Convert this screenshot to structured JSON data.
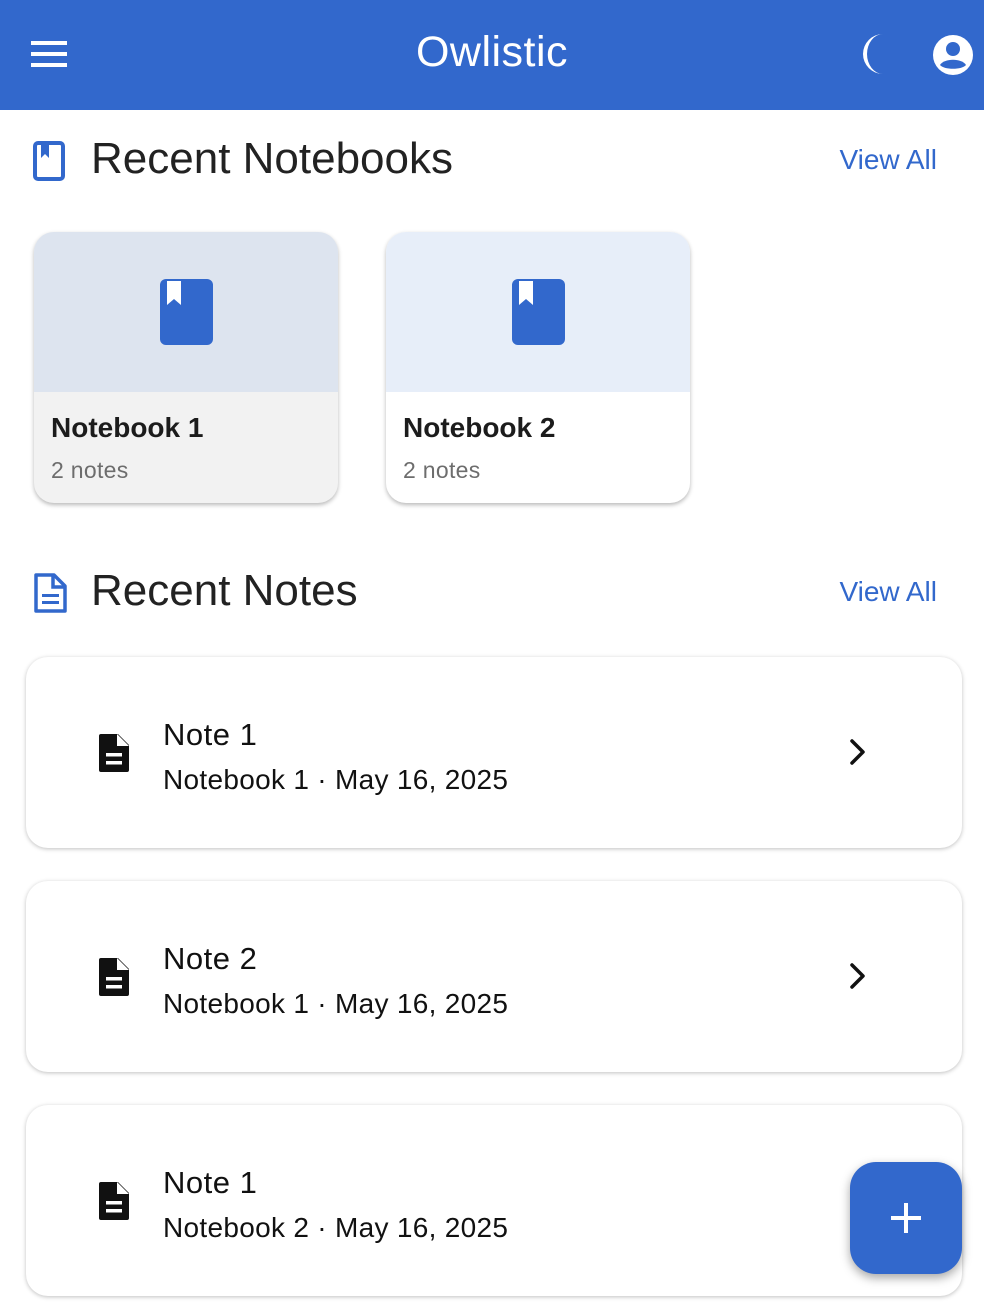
{
  "app": {
    "title": "Owlistic",
    "accent": "#3268cc",
    "icons": {
      "menu": "menu-icon",
      "theme": "moon-icon",
      "account": "account-circle-icon"
    }
  },
  "recent_notebooks": {
    "title": "Recent Notebooks",
    "view_all": "View All",
    "icon": "bookmark-book-icon",
    "items": [
      {
        "name": "Notebook 1",
        "count": "2 notes",
        "icon": "book-icon"
      },
      {
        "name": "Notebook 2",
        "count": "2 notes",
        "icon": "book-icon"
      }
    ]
  },
  "recent_notes": {
    "title": "Recent Notes",
    "view_all": "View All",
    "icon": "document-outline-icon",
    "items": [
      {
        "title": "Note 1",
        "meta": "Notebook 1 · May 16, 2025",
        "icon": "document-icon"
      },
      {
        "title": "Note 2",
        "meta": "Notebook 1 · May 16, 2025",
        "icon": "document-icon"
      },
      {
        "title": "Note 1",
        "meta": "Notebook 2 · May 16, 2025",
        "icon": "document-icon"
      }
    ]
  },
  "fab": {
    "icon": "plus-icon"
  }
}
